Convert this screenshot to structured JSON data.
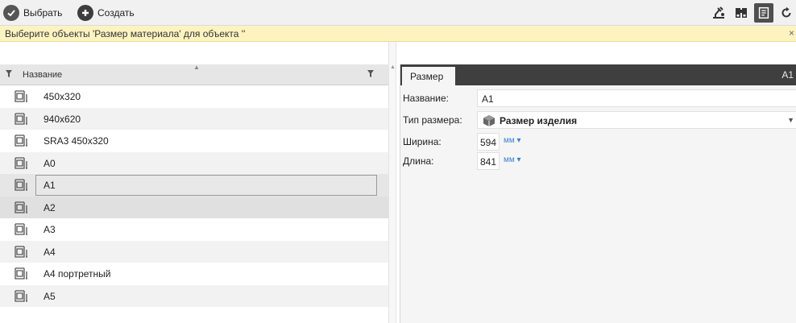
{
  "toolbar": {
    "select_label": "Выбрать",
    "create_label": "Создать",
    "select_icon_color": "#555555",
    "create_icon_color": "#3d3d3d"
  },
  "infobar": {
    "message": "Выберите объекты 'Размер материала' для объекта ''",
    "close": "×"
  },
  "list": {
    "column_header": "Название",
    "rows": [
      {
        "label": "450x320"
      },
      {
        "label": "940x620"
      },
      {
        "label": "SRA3 450x320"
      },
      {
        "label": "A0"
      },
      {
        "label": "A1"
      },
      {
        "label": "A2"
      },
      {
        "label": "A3"
      },
      {
        "label": "A4"
      },
      {
        "label": "A4 портретный"
      },
      {
        "label": "A5"
      }
    ]
  },
  "detail": {
    "tab_label": "Размер",
    "tab_right": "A1",
    "name_label": "Название:",
    "name_value": "A1",
    "type_label": "Тип размера:",
    "type_value": "Размер изделия",
    "width_label": "Ширина:",
    "width_value": "594",
    "width_unit": "мм ▾",
    "length_label": "Длина:",
    "length_value": "841",
    "length_unit": "мм ▾"
  }
}
